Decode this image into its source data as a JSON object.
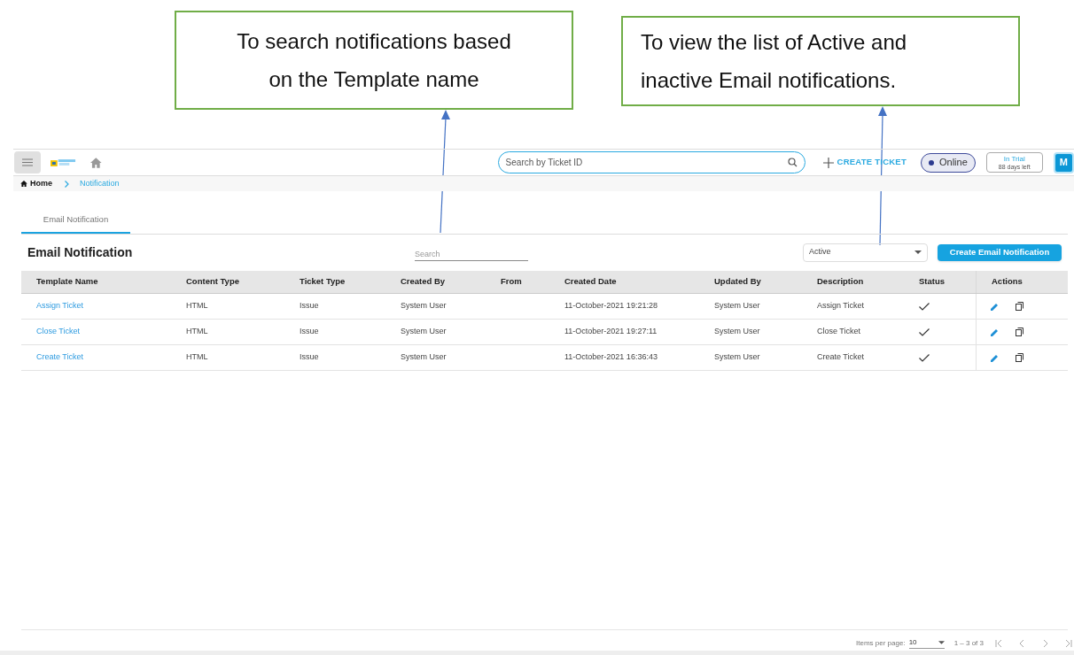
{
  "callouts": [
    {
      "text": "To search notifications based on the Template name"
    },
    {
      "text": "To view the list of Active and inactive Email notifications."
    }
  ],
  "topbar": {
    "search_placeholder": "Search by Ticket ID",
    "create_ticket": "CREATE TICKET",
    "presence": {
      "label": "Online",
      "on": true
    },
    "trial": {
      "title": "In Trial",
      "subtitle": "88 days left"
    },
    "avatar": "M"
  },
  "breadcrumb": [
    {
      "label": "Home",
      "selected": false
    },
    {
      "label": "Notification",
      "selected": true
    }
  ],
  "tabs": [
    {
      "label": "Email Notification",
      "selected": true
    }
  ],
  "title": "Email Notification",
  "search": {
    "placeholder": "Search"
  },
  "status_filter": {
    "value": "Active"
  },
  "create_button": "Create Email Notification",
  "table": {
    "columns": [
      "Template Name",
      "Content Type",
      "Ticket Type",
      "Created By",
      "From",
      "Created Date",
      "Updated By",
      "Description",
      "Status",
      "Actions"
    ],
    "rows": [
      {
        "template_name": "Assign Ticket",
        "content_type": "HTML",
        "ticket_type": "Issue",
        "created_by": "System User",
        "from": "",
        "created_date": "11-October-2021 19:21:28",
        "updated_by": "System User",
        "description": "Assign Ticket",
        "status": true
      },
      {
        "template_name": "Close Ticket",
        "content_type": "HTML",
        "ticket_type": "Issue",
        "created_by": "System User",
        "from": "",
        "created_date": "11-October-2021 19:27:11",
        "updated_by": "System User",
        "description": "Close Ticket",
        "status": true
      },
      {
        "template_name": "Create Ticket",
        "content_type": "HTML",
        "ticket_type": "Issue",
        "created_by": "System User",
        "from": "",
        "created_date": "11-October-2021 16:36:43",
        "updated_by": "System User",
        "description": "Create Ticket",
        "status": true
      }
    ]
  },
  "pagination": {
    "label": "Items per page:",
    "page_size": "10",
    "range": "1 – 3 of 3"
  }
}
